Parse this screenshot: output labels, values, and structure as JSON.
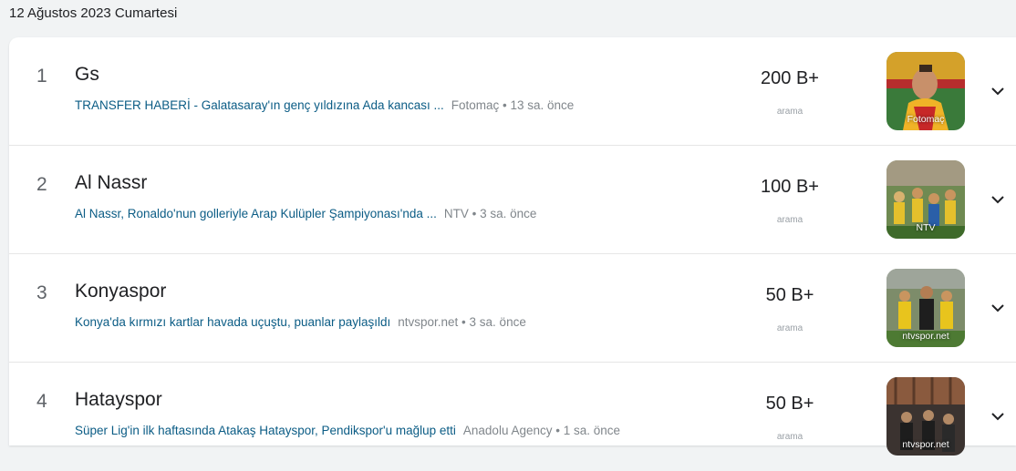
{
  "date_header": "12 Ağustos 2023 Cumartesi",
  "items": [
    {
      "rank": "1",
      "title": "Gs",
      "news_title": "TRANSFER HABERİ - Galatasaray'ın genç yıldızına Ada kancası ...",
      "news_meta": "Fotomaç • 13 sa. önce",
      "count": "200 B+",
      "count_label": "arama",
      "image_source": "Fotomaç"
    },
    {
      "rank": "2",
      "title": "Al Nassr",
      "news_title": "Al Nassr, Ronaldo'nun golleriyle Arap Kulüpler Şampiyonası'nda ...",
      "news_meta": "NTV • 3 sa. önce",
      "count": "100 B+",
      "count_label": "arama",
      "image_source": "NTV"
    },
    {
      "rank": "3",
      "title": "Konyaspor",
      "news_title": "Konya'da kırmızı kartlar havada uçuştu, puanlar paylaşıldı",
      "news_meta": "ntvspor.net • 3 sa. önce",
      "count": "50 B+",
      "count_label": "arama",
      "image_source": "ntvspor.net"
    },
    {
      "rank": "4",
      "title": "Hatayspor",
      "news_title": "Süper Lig'in ilk haftasında Atakaş Hatayspor, Pendikspor'u mağlup etti",
      "news_meta": "Anadolu Agency • 1 sa. önce",
      "count": "50 B+",
      "count_label": "arama",
      "image_source": "ntvspor.net"
    }
  ],
  "icons": {
    "expand": "chevron-down-icon"
  }
}
